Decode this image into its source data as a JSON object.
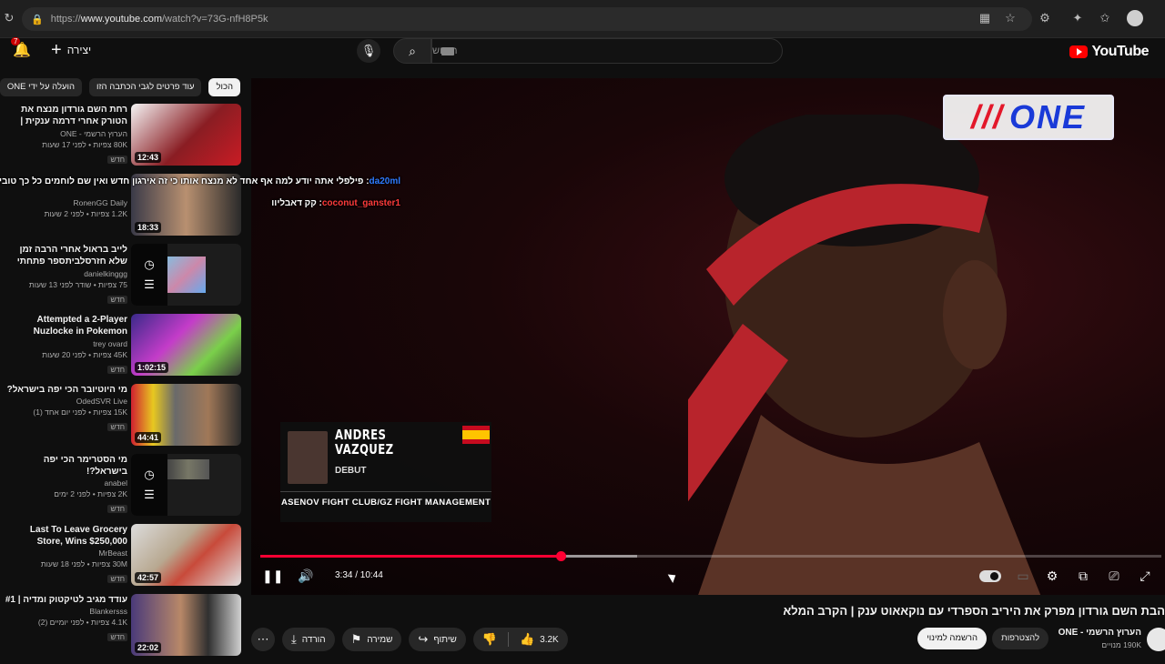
{
  "browser": {
    "url_prefix": "https://",
    "url_domain": "www.youtube.com",
    "url_path": "/watch?v=73G-nfH8P5k"
  },
  "header": {
    "logo_text": "YouTube",
    "search_placeholder": "חיפוש",
    "create_label": "יצירה",
    "notifications_count": "7"
  },
  "chips": [
    "הכול",
    "עוד פרטים לגבי הכתבה הזו",
    "הועלה על ידי ONE"
  ],
  "recommendations": [
    {
      "title": "רחת השם גורדון מנצח את הטורק אחרי דרמה ענקית | הקרב המלא!",
      "channel": "הערוץ הרשמי - ONE",
      "stats": "80K צפיות • לפני 17 שעות",
      "badge": "חדש",
      "duration": "12:43"
    },
    {
      "title": "",
      "channel": "RonenGG Daily",
      "stats": "1.2K צפיות • לפני 2 שעות",
      "badge": "",
      "duration": "18:33"
    },
    {
      "title": "לייב בראול אחרי הרבה זמן שלא חזרסלביתספר פתחתי קלאן בשם...",
      "channel": "danielkinggg",
      "stats": "75 צפיות • שודר לפני 13 שעות",
      "badge": "חדש",
      "duration": ""
    },
    {
      "title": "Attempted a 2-Player Nuzlocke in Pokemon Minecraft",
      "channel": "trey ovard",
      "stats": "45K צפיות • לפני 20 שעות",
      "badge": "חדש",
      "duration": "1:02:15"
    },
    {
      "title": "מי היוטיובר הכי יפה בישראל?",
      "channel": "OdedSVR Live",
      "stats": "15K צפיות • לפני יום אחד (1)",
      "badge": "חדש",
      "duration": "44:41"
    },
    {
      "title": "מי הסטרימר הכי יפה בישראל?!",
      "channel": "anabel",
      "stats": "2K צפיות • לפני 2 ימים",
      "badge": "חדש",
      "duration": ""
    },
    {
      "title": "Last To Leave Grocery Store, Wins $250,000",
      "channel": "MrBeast",
      "stats": "30M צפיות • לפני 18 שעות",
      "badge": "חדש",
      "duration": "42:57"
    },
    {
      "title": "עודד מגיב לטיקטוק ומדיה | #1",
      "channel": "Blankersss",
      "stats": "4.1K צפיות • לפני יומיים (2)",
      "badge": "חדש",
      "duration": "22:02"
    }
  ],
  "chat_overlay": [
    {
      "nick": "da20ml",
      "text": "פילפלי אתה יודע למה אף אחד לא מנצח אותו כי זה אירגון חדש ואין שם לוחמים כל כך טובים"
    },
    {
      "nick": "coconut_ganster1",
      "text": "קק דאבליוו"
    }
  ],
  "player": {
    "current_time": "3:34",
    "duration": "10:44",
    "time_display": "3:34 / 10:44",
    "played_fraction": 0.333,
    "buffered_fraction": 0.418,
    "watermark": "ONE",
    "lower_third": {
      "name_line1": "ANDRES",
      "name_line2": "VAZQUEZ",
      "tag": "DEBUT",
      "team": "ASENOV FIGHT CLUB/GZ FIGHT MANAGEMENT"
    }
  },
  "video": {
    "title": "הבת השם גורדון מפרק את היריב הספרדי עם נוקאאוט ענק | הקרב המלא",
    "channel": "הערוץ הרשמי - ONE",
    "subscribers": "190K מנויים",
    "join_label": "להצטרפות",
    "subscribe_label": "הרשמה למינוי",
    "likes": "3.2K",
    "share_label": "שיתוף",
    "save_label": "שמירה",
    "download_label": "הורדה"
  },
  "colors": {
    "accent": "#ff0033",
    "bg": "#0f0f0f",
    "chip_bg": "#272727"
  }
}
